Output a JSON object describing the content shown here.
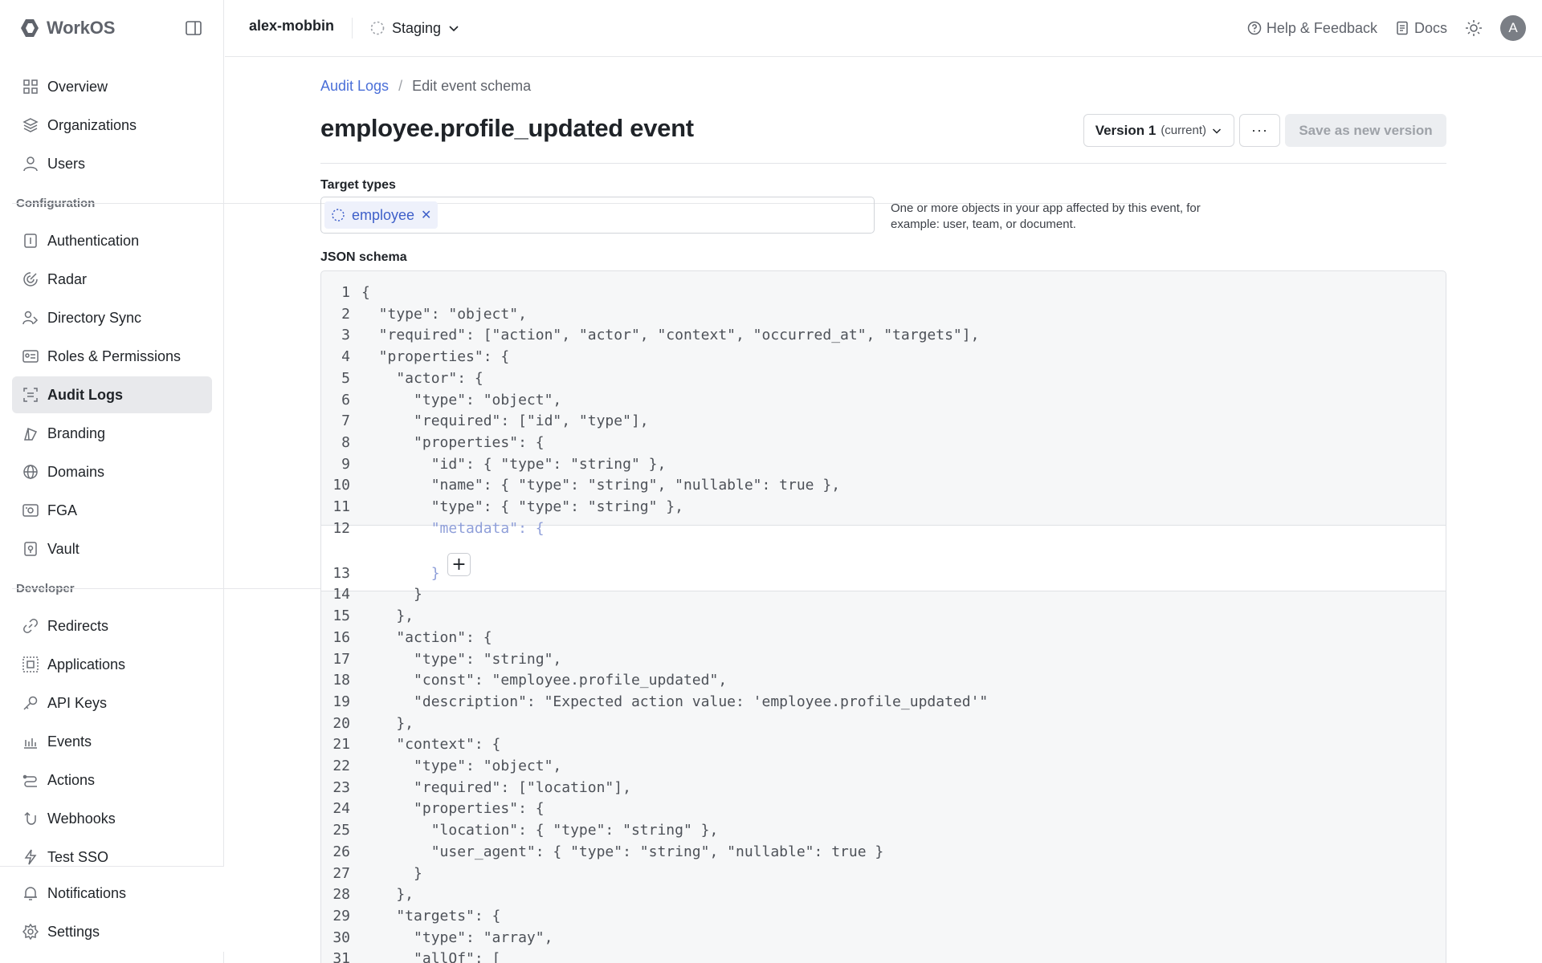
{
  "app": {
    "brand": "WorkOS"
  },
  "sidebar": {
    "items_top": [
      {
        "label": "Overview",
        "icon": "grid-icon"
      },
      {
        "label": "Organizations",
        "icon": "layers-icon"
      },
      {
        "label": "Users",
        "icon": "user-icon"
      }
    ],
    "section_config": "Configuration",
    "items_config": [
      {
        "label": "Authentication",
        "icon": "key-box-icon"
      },
      {
        "label": "Radar",
        "icon": "radar-icon"
      },
      {
        "label": "Directory Sync",
        "icon": "users-sync-icon"
      },
      {
        "label": "Roles & Permissions",
        "icon": "id-card-icon"
      },
      {
        "label": "Audit Logs",
        "icon": "audit-icon",
        "active": true
      },
      {
        "label": "Branding",
        "icon": "brush-icon"
      },
      {
        "label": "Domains",
        "icon": "globe-icon"
      },
      {
        "label": "FGA",
        "icon": "fga-icon"
      },
      {
        "label": "Vault",
        "icon": "vault-icon"
      }
    ],
    "section_dev": "Developer",
    "items_dev": [
      {
        "label": "Redirects",
        "icon": "link-icon"
      },
      {
        "label": "Applications",
        "icon": "app-icon"
      },
      {
        "label": "API Keys",
        "icon": "key-icon"
      },
      {
        "label": "Events",
        "icon": "events-icon"
      },
      {
        "label": "Actions",
        "icon": "actions-icon"
      },
      {
        "label": "Webhooks",
        "icon": "webhook-icon"
      },
      {
        "label": "Test SSO",
        "icon": "bolt-icon"
      }
    ],
    "items_bottom": [
      {
        "label": "Notifications",
        "icon": "bell-icon"
      },
      {
        "label": "Settings",
        "icon": "gear-icon"
      }
    ]
  },
  "topbar": {
    "org": "alex-mobbin",
    "environment": "Staging",
    "help": "Help & Feedback",
    "docs": "Docs",
    "avatar_initial": "A"
  },
  "breadcrumb": {
    "parent": "Audit Logs",
    "separator": "/",
    "current": "Edit event schema"
  },
  "page": {
    "title": "employee.profile_updated event",
    "version_label": "Version 1",
    "version_sub": "(current)",
    "more": "···",
    "save_label": "Save as new version"
  },
  "targets": {
    "label": "Target types",
    "chips": [
      "employee"
    ],
    "help": "One or more objects in your app affected by this event, for example: user, team, or document."
  },
  "schema": {
    "label": "JSON schema",
    "lines": [
      "{",
      "  \"type\": \"object\",",
      "  \"required\": [\"action\", \"actor\", \"context\", \"occurred_at\", \"targets\"],",
      "  \"properties\": {",
      "    \"actor\": {",
      "      \"type\": \"object\",",
      "      \"required\": [\"id\", \"type\"],",
      "      \"properties\": {",
      "        \"id\": { \"type\": \"string\" },",
      "        \"name\": { \"type\": \"string\", \"nullable\": true },",
      "        \"type\": { \"type\": \"string\" },",
      "        \"metadata\": {",
      "        }",
      "      }",
      "    },",
      "    \"action\": {",
      "      \"type\": \"string\",",
      "      \"const\": \"employee.profile_updated\",",
      "      \"description\": \"Expected action value: 'employee.profile_updated'\"",
      "    },",
      "    \"context\": {",
      "      \"type\": \"object\",",
      "      \"required\": [\"location\"],",
      "      \"properties\": {",
      "        \"location\": { \"type\": \"string\" },",
      "        \"user_agent\": { \"type\": \"string\", \"nullable\": true }",
      "      }",
      "    },",
      "    \"targets\": {",
      "      \"type\": \"array\",",
      "      \"allOf\": ["
    ]
  }
}
